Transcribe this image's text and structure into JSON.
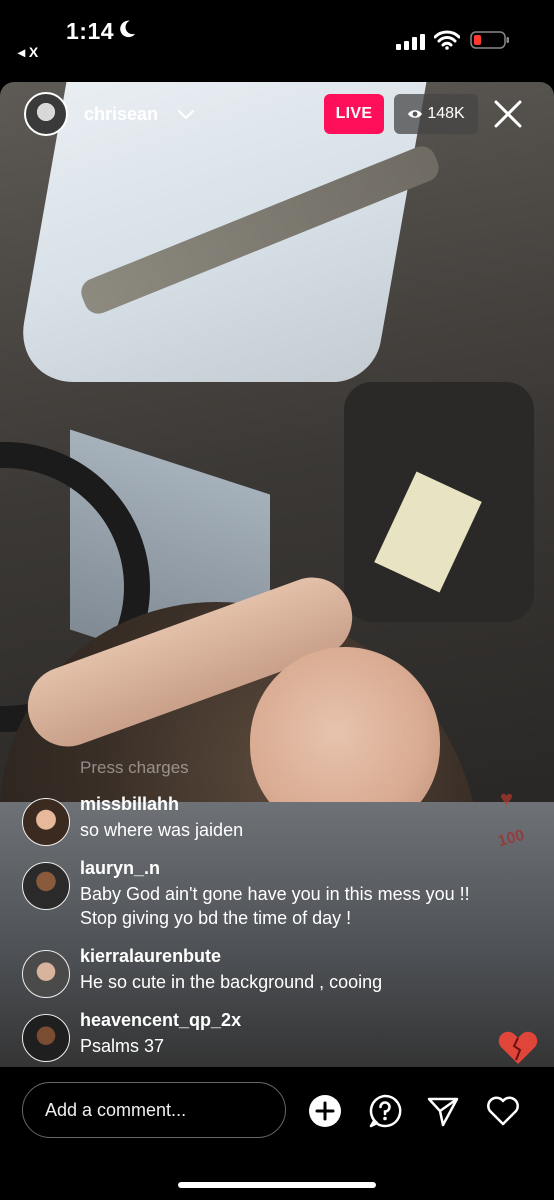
{
  "status_bar": {
    "time": "1:14",
    "back_app": "◂ X",
    "icons": [
      "moon-icon",
      "signal-icon",
      "wifi-icon",
      "battery-low-icon"
    ],
    "battery_color": "#ff3b30"
  },
  "header": {
    "username": "chrisean",
    "live_label": "LIVE",
    "viewer_count": "148K",
    "live_color": "#ff0f5a"
  },
  "comments": {
    "faded": "Press charges",
    "items": [
      {
        "username": "missbillahh",
        "text": "so where was jaiden"
      },
      {
        "username": "lauryn_.n",
        "text": "Baby God ain't gone have you in this mess you !! Stop giving yo bd the time of day !"
      },
      {
        "username": "kierralaurenbute",
        "text": "He so cute in the background , cooing"
      },
      {
        "username": "heavencent_qp_2x",
        "text": "Psalms 37"
      }
    ]
  },
  "reactions": {
    "side_badge": "100"
  },
  "bottom_bar": {
    "comment_placeholder": "Add a comment...",
    "icons": [
      "add-circle-icon",
      "question-icon",
      "send-icon",
      "heart-icon"
    ]
  }
}
